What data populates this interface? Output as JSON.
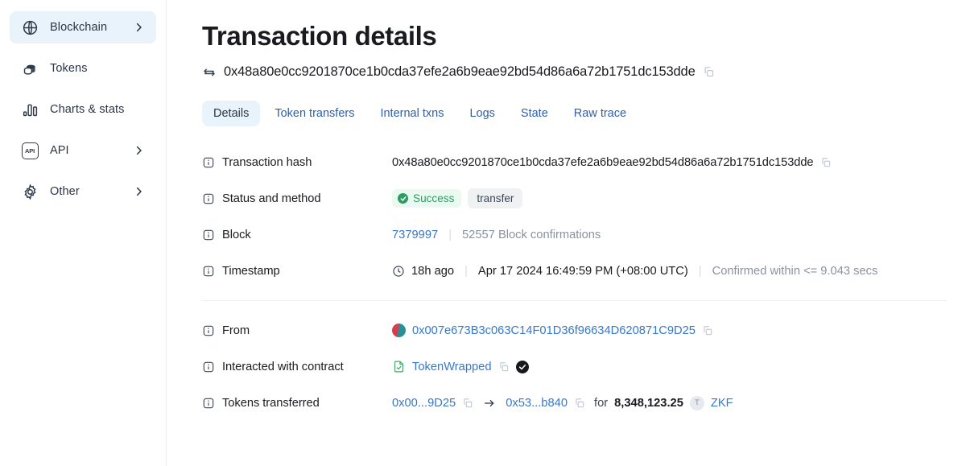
{
  "sidebar": {
    "items": [
      {
        "label": "Blockchain",
        "icon": "globe-icon",
        "chevron": true,
        "active": true
      },
      {
        "label": "Tokens",
        "icon": "coins-icon",
        "chevron": false,
        "active": false
      },
      {
        "label": "Charts & stats",
        "icon": "chart-icon",
        "chevron": false,
        "active": false
      },
      {
        "label": "API",
        "icon": "api-icon",
        "chevron": true,
        "active": false
      },
      {
        "label": "Other",
        "icon": "gear-icon",
        "chevron": true,
        "active": false
      }
    ]
  },
  "header": {
    "title": "Transaction details",
    "hash": "0x48a80e0cc9201870ce1b0cda37efe2a6b9eae92bd54d86a6a72b1751dc153dde",
    "swap_icon": "swap-arrows-icon",
    "copy_icon": "copy-icon"
  },
  "tabs": [
    {
      "label": "Details",
      "active": true
    },
    {
      "label": "Token transfers",
      "active": false
    },
    {
      "label": "Internal txns",
      "active": false
    },
    {
      "label": "Logs",
      "active": false
    },
    {
      "label": "State",
      "active": false
    },
    {
      "label": "Raw trace",
      "active": false
    }
  ],
  "details": {
    "transaction_hash": {
      "label": "Transaction hash",
      "value": "0x48a80e0cc9201870ce1b0cda37efe2a6b9eae92bd54d86a6a72b1751dc153dde"
    },
    "status_and_method": {
      "label": "Status and method",
      "status": "Success",
      "method": "transfer"
    },
    "block": {
      "label": "Block",
      "number": "7379997",
      "confirmations": "52557 Block confirmations"
    },
    "timestamp": {
      "label": "Timestamp",
      "relative": "18h ago",
      "absolute": "Apr 17 2024 16:49:59 PM (+08:00 UTC)",
      "confirmed_within": "Confirmed within <= 9.043 secs"
    },
    "from": {
      "label": "From",
      "address": "0x007e673B3c063C14F01D36f96634D620871C9D25"
    },
    "interacted_with_contract": {
      "label": "Interacted with contract",
      "contract_name": "TokenWrapped"
    },
    "tokens_transferred": {
      "label": "Tokens transferred",
      "from_short": "0x00...9D25",
      "to_short": "0x53...b840",
      "for_word": "for",
      "amount": "8,348,123.25",
      "token_letter": "T",
      "token_symbol": "ZKF"
    }
  },
  "colors": {
    "accent_link": "#3878c8",
    "active_bg": "#e9f3fc",
    "success_green": "#2e9b62",
    "success_bg": "#eafaf0",
    "muted_text": "#8a929f"
  }
}
